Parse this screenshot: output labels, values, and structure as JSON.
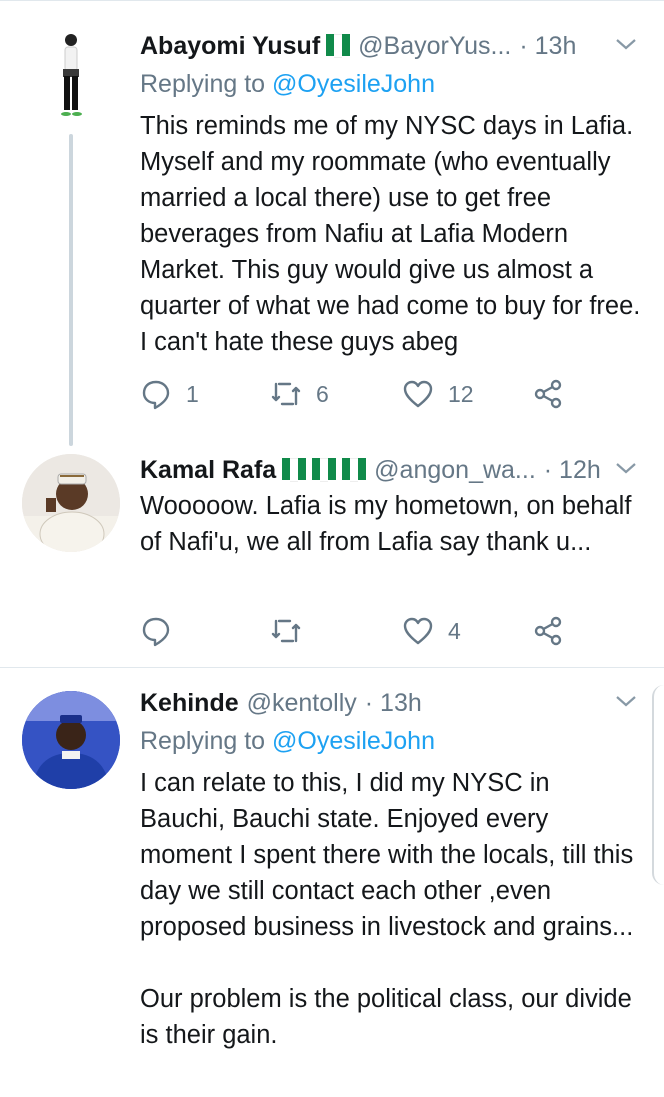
{
  "tweets": [
    {
      "name": "Abayomi Yusuf",
      "handle": "@BayorYus...",
      "time": "· 13h",
      "replying_prefix": "Replying to ",
      "replying_to": "@OyesileJohn",
      "text": "This reminds me of my NYSC days in Lafia. Myself and my roommate (who eventually married a local there) use to get free beverages from Nafiu at Lafia Modern Market. This guy would give us almost a quarter of what we had come to buy for free. I can't hate these guys abeg",
      "reply_count": "1",
      "retweet_count": "6",
      "like_count": "12"
    },
    {
      "name": "Kamal Rafa",
      "handle": "@angon_wa...",
      "time": "· 12h",
      "text": "Wooooow. Lafia is my hometown, on behalf of Nafi'u, we all from Lafia say thank u...",
      "reply_count": "",
      "retweet_count": "",
      "like_count": "4"
    },
    {
      "name": "Kehinde",
      "handle": "@kentolly",
      "time": "· 13h",
      "replying_prefix": "Replying to ",
      "replying_to": "@OyesileJohn",
      "text": "I can relate to this, I did my NYSC in Bauchi, Bauchi state. Enjoyed every moment I spent there with the locals, till this day we still contact each other ,even proposed business in livestock and grains...\n\nOur problem is the political class, our divide is their gain."
    }
  ],
  "colors": {
    "link": "#1da1f2",
    "secondary_text": "#657786",
    "flag_green": "#108a4a"
  },
  "icons": [
    "reply-icon",
    "retweet-icon",
    "like-icon",
    "share-icon",
    "chevron-down-icon"
  ]
}
